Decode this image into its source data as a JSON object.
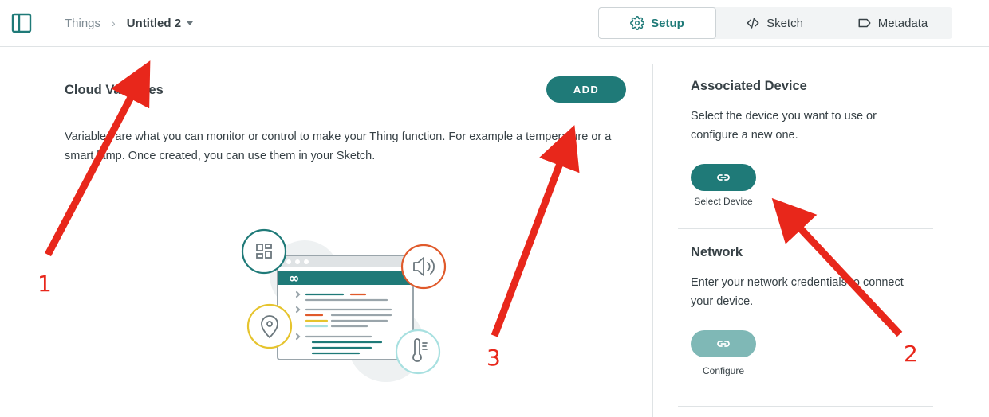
{
  "header": {
    "breadcrumb_root": "Things",
    "breadcrumb_separator": "›",
    "thing_name": "Untitled 2",
    "tabs": [
      {
        "label": "Setup",
        "icon": "gear-icon",
        "active": true
      },
      {
        "label": "Sketch",
        "icon": "code-icon",
        "active": false
      },
      {
        "label": "Metadata",
        "icon": "tag-icon",
        "active": false
      }
    ]
  },
  "cloud_variables": {
    "title": "Cloud Variables",
    "add_label": "ADD",
    "description": "Variables are what you can monitor or control to make your Thing function. For example a temperature or a smart lamp. Once created, you can use them in your Sketch."
  },
  "associated_device": {
    "title": "Associated Device",
    "description": "Select the device you want to use or configure a new one.",
    "button_icon": "link-icon",
    "button_caption": "Select Device"
  },
  "network": {
    "title": "Network",
    "description": "Enter your network credentials to connect your device.",
    "button_icon": "link-icon",
    "button_caption": "Configure"
  },
  "annotations": {
    "arrow_1_label": "1",
    "arrow_2_label": "2",
    "arrow_3_label": "3",
    "color": "#e8271b"
  },
  "colors": {
    "accent": "#1f7a78",
    "accent_disabled": "#7fb8b6",
    "text": "#374146",
    "muted": "#7f8c94"
  }
}
